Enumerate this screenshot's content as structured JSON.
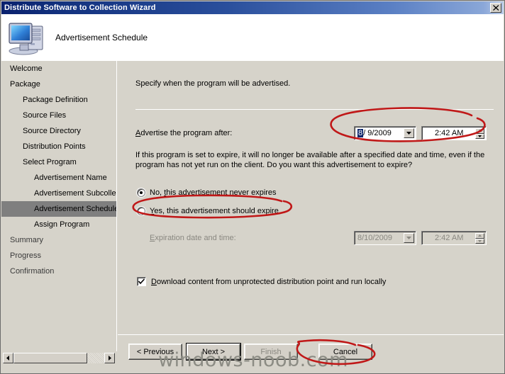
{
  "window": {
    "title": "Distribute Software to Collection Wizard",
    "close_label": "close-icon"
  },
  "header": {
    "title": "Advertisement Schedule",
    "icon": "computer-icon"
  },
  "sidebar": {
    "items": [
      {
        "label": "Welcome",
        "level": 1,
        "selected": false
      },
      {
        "label": "Package",
        "level": 1,
        "selected": false
      },
      {
        "label": "Package Definition",
        "level": 2,
        "selected": false
      },
      {
        "label": "Source Files",
        "level": 2,
        "selected": false
      },
      {
        "label": "Source Directory",
        "level": 2,
        "selected": false
      },
      {
        "label": "Distribution Points",
        "level": 2,
        "selected": false
      },
      {
        "label": "Select Program",
        "level": 2,
        "selected": false
      },
      {
        "label": "Advertisement Name",
        "level": 3,
        "selected": false
      },
      {
        "label": "Advertisement Subcollec",
        "level": 3,
        "selected": false
      },
      {
        "label": "Advertisement Schedule",
        "level": 3,
        "selected": true
      },
      {
        "label": "Assign Program",
        "level": 3,
        "selected": false
      },
      {
        "label": "Summary",
        "level": 1,
        "selected": false
      },
      {
        "label": "Progress",
        "level": 1,
        "selected": false
      },
      {
        "label": "Confirmation",
        "level": 1,
        "selected": false
      }
    ],
    "scrollbar": {
      "left_arrow": "◄",
      "right_arrow": "►"
    }
  },
  "main": {
    "intro": "Specify when the program will be advertised.",
    "advertise_label_prefix": "A",
    "advertise_label_rest": "dvertise the program after:",
    "advertise_date": {
      "selected_part": "8",
      "rest": "/  9/2009",
      "dropdown_icon": "chevron-down-icon"
    },
    "advertise_time": "2:42 AM",
    "expire_question": "If this program is set to expire, it will no longer be available after a specified date and time, even if the program has not yet run on the client. Do you want this advertisement to expire?",
    "radio_no": {
      "prefix": "No, ",
      "accel": "t",
      "rest": "his advertisement never expires",
      "checked": true
    },
    "radio_yes": {
      "prefix": "",
      "accel": "Y",
      "rest": "es, this advertisement should expire",
      "checked": false
    },
    "expiration_label_prefix": "E",
    "expiration_label_rest": "xpiration date and time:",
    "expiration_date": "8/10/2009",
    "expiration_time": "2:42 AM",
    "expiration_disabled": true,
    "download_checkbox": {
      "prefix": "",
      "accel": "D",
      "rest": "ownload content from unprotected distribution point and run locally",
      "checked": true
    }
  },
  "buttons": {
    "previous": "< Previous",
    "next": "Next >",
    "finish": "Finish",
    "cancel": "Cancel"
  },
  "watermark": "windows-noob.com",
  "colors": {
    "titlebar_start": "#0a216e",
    "titlebar_end": "#b9cbe8",
    "window_face": "#d6d3ca",
    "selection_blue": "#0a246a",
    "nav_selected": "#7f7f7f",
    "annotation_red": "#cc1111",
    "disabled_text": "#8a8881"
  }
}
